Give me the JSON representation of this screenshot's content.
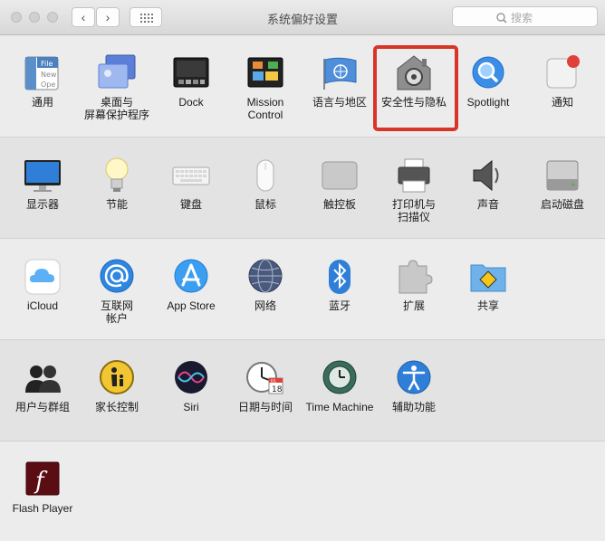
{
  "window": {
    "title": "系统偏好设置",
    "search_placeholder": "搜索",
    "nav": {
      "back": "‹",
      "forward": "›"
    }
  },
  "sections": [
    {
      "items": [
        {
          "label": "通用",
          "icon": "general-icon"
        },
        {
          "label": "桌面与\n屏幕保护程序",
          "icon": "desktop-screensaver-icon"
        },
        {
          "label": "Dock",
          "icon": "dock-icon"
        },
        {
          "label": "Mission\nControl",
          "icon": "mission-control-icon"
        },
        {
          "label": "语言与地区",
          "icon": "language-region-icon"
        },
        {
          "label": "安全性与隐私",
          "icon": "security-privacy-icon"
        },
        {
          "label": "Spotlight",
          "icon": "spotlight-icon"
        },
        {
          "label": "通知",
          "icon": "notifications-icon"
        }
      ]
    },
    {
      "items": [
        {
          "label": "显示器",
          "icon": "displays-icon"
        },
        {
          "label": "节能",
          "icon": "energy-saver-icon"
        },
        {
          "label": "键盘",
          "icon": "keyboard-icon"
        },
        {
          "label": "鼠标",
          "icon": "mouse-icon"
        },
        {
          "label": "触控板",
          "icon": "trackpad-icon"
        },
        {
          "label": "打印机与\n扫描仪",
          "icon": "printer-scanner-icon"
        },
        {
          "label": "声音",
          "icon": "sound-icon"
        },
        {
          "label": "启动磁盘",
          "icon": "startup-disk-icon"
        }
      ]
    },
    {
      "items": [
        {
          "label": "iCloud",
          "icon": "icloud-icon"
        },
        {
          "label": "互联网\n帐户",
          "icon": "internet-accounts-icon"
        },
        {
          "label": "App Store",
          "icon": "app-store-icon"
        },
        {
          "label": "网络",
          "icon": "network-icon"
        },
        {
          "label": "蓝牙",
          "icon": "bluetooth-icon"
        },
        {
          "label": "扩展",
          "icon": "extensions-icon"
        },
        {
          "label": "共享",
          "icon": "sharing-icon"
        }
      ]
    },
    {
      "items": [
        {
          "label": "用户与群组",
          "icon": "users-groups-icon"
        },
        {
          "label": "家长控制",
          "icon": "parental-controls-icon"
        },
        {
          "label": "Siri",
          "icon": "siri-icon"
        },
        {
          "label": "日期与时间",
          "icon": "date-time-icon"
        },
        {
          "label": "Time Machine",
          "icon": "time-machine-icon"
        },
        {
          "label": "辅助功能",
          "icon": "accessibility-icon"
        }
      ]
    },
    {
      "items": [
        {
          "label": "Flash Player",
          "icon": "flash-player-icon"
        }
      ]
    }
  ],
  "icon_text": {
    "general_file": "File",
    "general_new": "New",
    "general_open": "Ope",
    "calendar_month": "JUL",
    "calendar_day": "18",
    "flash_f": "f"
  },
  "highlight_color": "#d8342a"
}
